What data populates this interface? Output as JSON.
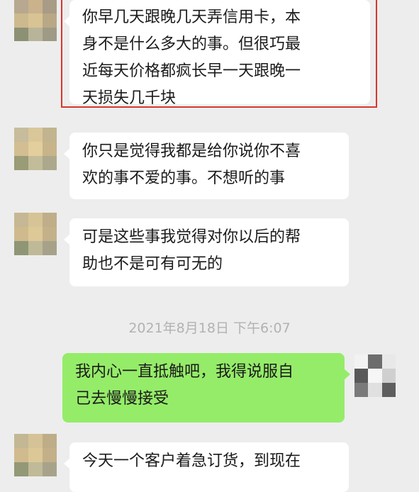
{
  "chat": {
    "messages": [
      {
        "side": "left",
        "lines": [
          "你早几天跟晚几天弄信用卡，本",
          "身不是什么多大的事。但很巧最",
          "近每天价格都疯长早一天跟晚一",
          "天损失几千块"
        ],
        "highlighted": true
      },
      {
        "side": "left",
        "lines": [
          "你只是觉得我都是给你说你不喜",
          "欢的事不爱的事。不想听的事"
        ]
      },
      {
        "side": "left",
        "lines": [
          "可是这些事我觉得对你以后的帮",
          "助也不是可有可无的"
        ]
      },
      {
        "side": "right",
        "lines": [
          "我内心一直抵触吧，我得说服自",
          "己去慢慢接受"
        ]
      },
      {
        "side": "left",
        "lines": [
          "今天一个客户着急订货，到现在"
        ]
      }
    ],
    "timestamp": "2021年8月18日 下午6:07"
  },
  "colors": {
    "background": "#ededed",
    "incoming_bubble": "#ffffff",
    "outgoing_bubble": "#95ec69",
    "highlight_border": "#d9362c",
    "timestamp_text": "#b2b2b2"
  },
  "icons": {
    "contact_avatar": "blurred-avatar-icon",
    "self_avatar": "blurred-avatar-icon"
  }
}
